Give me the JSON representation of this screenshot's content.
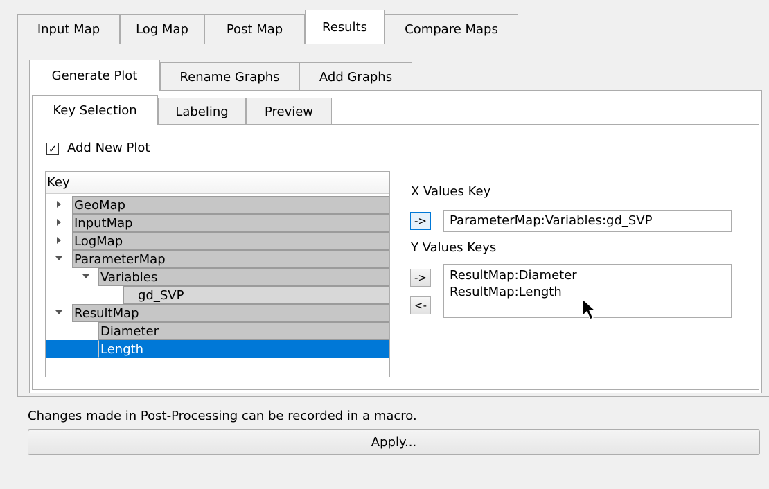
{
  "top_tabs": [
    "Input Map",
    "Log Map",
    "Post Map",
    "Results",
    "Compare Maps"
  ],
  "active_top_tab": "Results",
  "sub_tabs": [
    "Generate Plot",
    "Rename Graphs",
    "Add Graphs"
  ],
  "active_sub_tab": "Generate Plot",
  "inner_tabs": [
    "Key Selection",
    "Labeling",
    "Preview"
  ],
  "active_inner_tab": "Key Selection",
  "add_new_plot": {
    "label": "Add New Plot",
    "checked": true,
    "check_glyph": "✓"
  },
  "tree": {
    "header": "Key",
    "nodes": [
      {
        "label": "GeoMap",
        "expanded": false
      },
      {
        "label": "InputMap",
        "expanded": false
      },
      {
        "label": "LogMap",
        "expanded": false
      },
      {
        "label": "ParameterMap",
        "expanded": true
      },
      {
        "label": "Variables",
        "expanded": true
      },
      {
        "label": "gd_SVP"
      },
      {
        "label": "ResultMap",
        "expanded": true
      },
      {
        "label": "Diameter"
      },
      {
        "label": "Length",
        "selected": true
      }
    ]
  },
  "x_values": {
    "label": "X Values Key",
    "add_button": "->",
    "value": "ParameterMap:Variables:gd_SVP"
  },
  "y_values": {
    "label": "Y Values Keys",
    "add_button": "->",
    "remove_button": "<-",
    "items": [
      "ResultMap:Diameter",
      "ResultMap:Length"
    ]
  },
  "footer": {
    "note": "Changes made in Post-Processing can be recorded in a macro.",
    "apply_label": "Apply..."
  },
  "colors": {
    "selection": "#0078d7",
    "tree_row": "#c6c6c6",
    "window_bg": "#f0f0f0"
  }
}
